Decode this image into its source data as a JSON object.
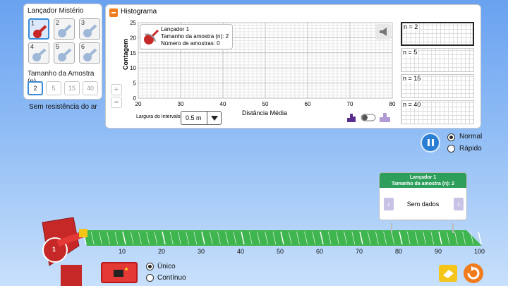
{
  "launcher_panel": {
    "title": "Lançador Mistério",
    "launchers": [
      {
        "num": "1",
        "selected": true
      },
      {
        "num": "2"
      },
      {
        "num": "3"
      },
      {
        "num": "4"
      },
      {
        "num": "5"
      },
      {
        "num": "6"
      }
    ],
    "sample_size_label": "Tamanho da Amostra (n)",
    "sample_sizes": [
      {
        "label": "2",
        "selected": true
      },
      {
        "label": "5"
      },
      {
        "label": "15"
      },
      {
        "label": "40"
      }
    ]
  },
  "air_resistance_label": "Sem resistência do ar",
  "histogram": {
    "title": "Histograma",
    "ylabel": "Contagem",
    "xlabel": "Distância Média",
    "y_ticks": [
      "25",
      "20",
      "15",
      "10",
      "5",
      "0"
    ],
    "x_ticks": [
      "20",
      "30",
      "40",
      "50",
      "60",
      "70",
      "80"
    ],
    "zoom_in": "+",
    "zoom_out": "−",
    "bin_width_label": "Largura do Intervalo",
    "bin_width_value": "0.5 m",
    "info": {
      "line1": "Lançador 1",
      "line2": "Tamanho da amostra (n): 2",
      "line3": "Número de amostras: 0"
    },
    "mini_histograms": [
      {
        "label": "n = 2",
        "selected": true
      },
      {
        "label": "n = 5"
      },
      {
        "label": "n = 15"
      },
      {
        "label": "n = 40"
      }
    ]
  },
  "speed": {
    "normal": "Normal",
    "fast": "Rápido",
    "selected": "normal"
  },
  "tooltip": {
    "line1": "Lançador 1",
    "line2": "Tamanho da amostra (n): 2",
    "body": "Sem dados"
  },
  "field": {
    "launcher_num": "1",
    "ticks": [
      "10",
      "20",
      "30",
      "40",
      "50",
      "60",
      "70",
      "80",
      "90",
      "100"
    ]
  },
  "launch_mode": {
    "single": "Único",
    "continuous": "Contínuo",
    "selected": "single"
  },
  "colors": {
    "accent": "#2a7fd4",
    "launcher": "#c62828",
    "field": "#3fb54f",
    "tooltip_header": "#2e9e5b",
    "panel_toggle": "#f07c1e"
  }
}
